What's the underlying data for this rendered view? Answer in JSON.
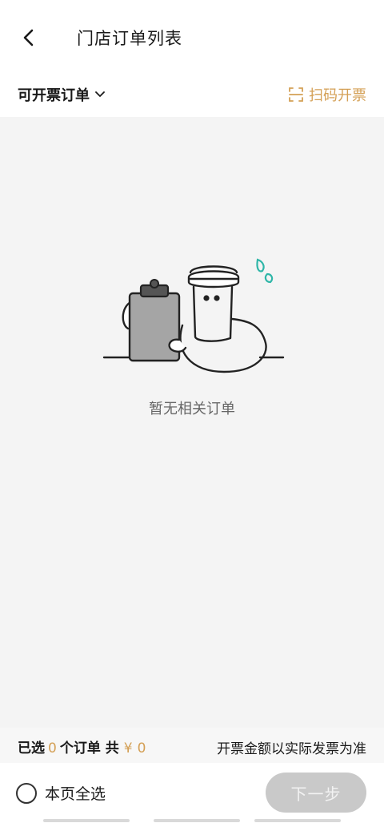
{
  "header": {
    "title": "门店订单列表",
    "back_icon": "chevron-left-icon"
  },
  "filter": {
    "label": "可开票订单",
    "dropdown_icon": "chevron-down-icon",
    "scan_label": "扫码开票",
    "scan_icon": "scan-icon"
  },
  "empty_state": {
    "message": "暂无相关订单",
    "illustration": "cup-holding-clipboard-illustration"
  },
  "summary": {
    "selected_prefix": "已选",
    "selected_count": "0",
    "orders_mid": "个订单 共",
    "currency": "¥",
    "total": "0",
    "note": "开票金额以实际发票为准"
  },
  "footer": {
    "select_all_label": "本页全选",
    "next_label": "下一步"
  },
  "colors": {
    "accent": "#d4a056",
    "disabled_button": "#c9c9c9",
    "background": "#f4f4f4",
    "drop_teal": "#2fb6a8"
  }
}
